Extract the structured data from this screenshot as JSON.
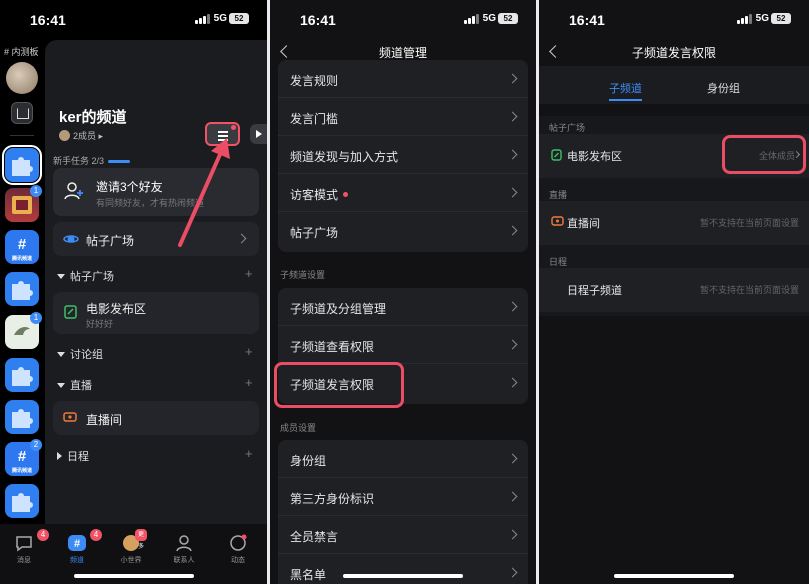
{
  "status": {
    "time": "16:41",
    "network": "5G",
    "battery": "52"
  },
  "panel1": {
    "rail_label": "# 内测板",
    "rail_badges": [
      "1",
      "1",
      "2"
    ],
    "rail_icon_texts": [
      "腾讯频道",
      "腾讯频道"
    ],
    "channel_title": "ker的频道",
    "member_count": "2成员",
    "task_label": "新手任务 2/3",
    "invite": {
      "title": "邀请3个好友",
      "subtitle": "有同频好友，才有热闹频道"
    },
    "forum_square": "帖子广场",
    "groups": [
      {
        "name": "帖子广场"
      },
      {
        "name": "讨论组"
      },
      {
        "name": "直播"
      },
      {
        "name": "日程"
      }
    ],
    "movie": {
      "name": "电影发布区",
      "sub": "好好好"
    },
    "live_room": "直播间",
    "tabs": [
      {
        "label": "消息",
        "badge": "4"
      },
      {
        "label": "频道",
        "badge": "4"
      },
      {
        "label": "小世界",
        "badge": "更多"
      },
      {
        "label": "联系人",
        "badge": ""
      },
      {
        "label": "动态",
        "badge": ""
      }
    ]
  },
  "panel2": {
    "title": "频道管理",
    "rows_top": [
      "发言规则",
      "发言门槛",
      "频道发现与加入方式",
      "访客模式",
      "帖子广场"
    ],
    "section_sub": "子频道设置",
    "rows_sub": [
      "子频道及分组管理",
      "子频道查看权限",
      "子频道发言权限"
    ],
    "section_member": "成员设置",
    "rows_member": [
      "身份组",
      "第三方身份标识",
      "全员禁言",
      "黑名单"
    ]
  },
  "panel3": {
    "title": "子频道发言权限",
    "tabs": [
      "子频道",
      "身份组"
    ],
    "sections": [
      {
        "header": "帖子广场",
        "item": "电影发布区",
        "value": "全体成员"
      },
      {
        "header": "直播",
        "item": "直播间",
        "value": "暂不支持在当前页面设置"
      },
      {
        "header": "日程",
        "item": "日程子频道",
        "value": "暂不支持在当前页面设置"
      }
    ]
  },
  "colors": {
    "accent": "#3d8cf5",
    "highlight": "#ea4d64",
    "badge": "#f05366",
    "background": "#121214"
  }
}
